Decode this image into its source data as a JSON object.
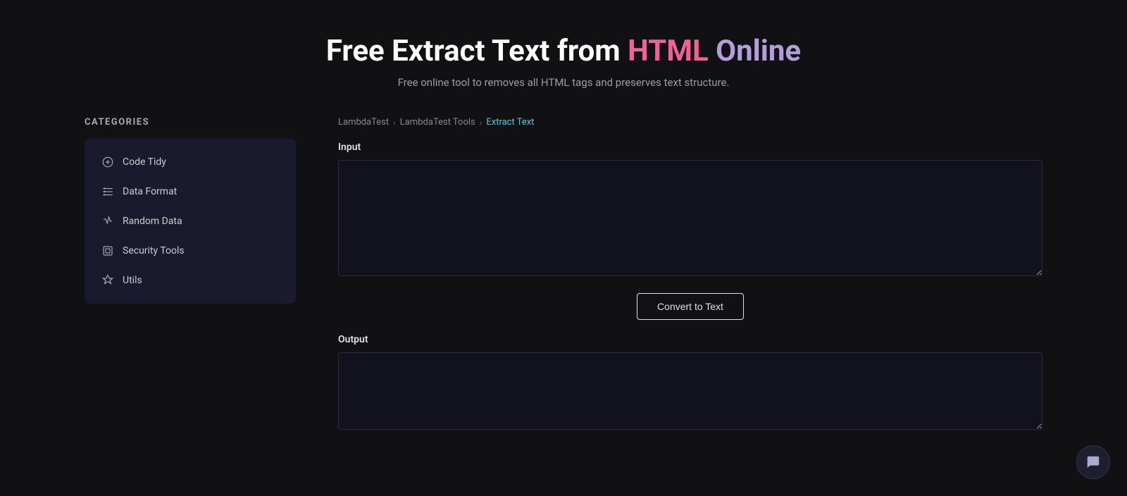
{
  "header": {
    "title_part1": "Free Extract Text from ",
    "title_highlight1": "HTML",
    "title_highlight2": " Online",
    "subtitle": "Free online tool to removes all HTML tags and preserves text structure."
  },
  "sidebar": {
    "categories_label": "CATEGORIES",
    "items": [
      {
        "id": "code-tidy",
        "label": "Code Tidy",
        "icon": "code-tidy-icon"
      },
      {
        "id": "data-format",
        "label": "Data Format",
        "icon": "data-format-icon"
      },
      {
        "id": "random-data",
        "label": "Random Data",
        "icon": "random-data-icon"
      },
      {
        "id": "security-tools",
        "label": "Security Tools",
        "icon": "security-tools-icon"
      },
      {
        "id": "utils",
        "label": "Utils",
        "icon": "utils-icon"
      }
    ]
  },
  "breadcrumb": {
    "items": [
      {
        "label": "LambdaTest",
        "active": false
      },
      {
        "label": "LambdaTest Tools",
        "active": false
      },
      {
        "label": "Extract Text",
        "active": true
      }
    ]
  },
  "input_section": {
    "label": "Input",
    "placeholder": ""
  },
  "convert_button": {
    "label": "Convert to Text"
  },
  "output_section": {
    "label": "Output",
    "placeholder": ""
  }
}
